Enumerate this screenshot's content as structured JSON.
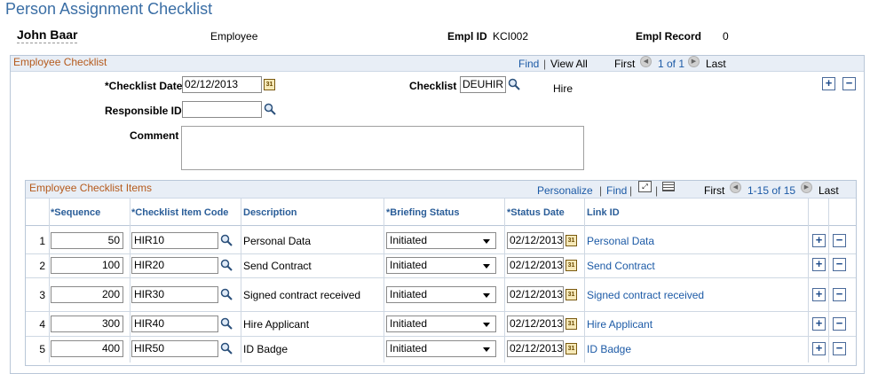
{
  "page": {
    "title": "Person Assignment Checklist"
  },
  "employee": {
    "name": "John Baar",
    "type": "Employee",
    "empl_id_label": "Empl ID",
    "empl_id": "KCI002",
    "empl_record_label": "Empl Record",
    "empl_record": "0"
  },
  "checklist_section": {
    "title": "Employee Checklist",
    "find": "Find",
    "separator": "|",
    "view_all": "View All",
    "first": "First",
    "pager": "1 of 1",
    "last": "Last",
    "checklist_date_label": "*Checklist Date",
    "checklist_date": "02/12/2013",
    "checklist_label": "Checklist",
    "checklist_value": "DEUHIR",
    "checklist_desc": "Hire",
    "responsible_id_label": "Responsible ID",
    "responsible_id": "",
    "comment_label": "Comment",
    "comment": ""
  },
  "items_grid": {
    "title": "Employee Checklist Items",
    "personalize": "Personalize",
    "separator": "|",
    "find": "Find",
    "first": "First",
    "pager": "1-15 of 15",
    "last": "Last",
    "columns": {
      "sequence": "*Sequence",
      "item_code": "*Checklist Item Code",
      "description": "Description",
      "briefing_status": "*Briefing Status",
      "status_date": "*Status Date",
      "link_id": "Link ID"
    },
    "rows": [
      {
        "n": "1",
        "sequence": "50",
        "code": "HIR10",
        "description": "Personal Data",
        "status": "Initiated",
        "date": "02/12/2013",
        "link": "Personal Data"
      },
      {
        "n": "2",
        "sequence": "100",
        "code": "HIR20",
        "description": "Send Contract",
        "status": "Initiated",
        "date": "02/12/2013",
        "link": "Send Contract"
      },
      {
        "n": "3",
        "sequence": "200",
        "code": "HIR30",
        "description": "Signed contract received",
        "status": "Initiated",
        "date": "02/12/2013",
        "link": "Signed contract received"
      },
      {
        "n": "4",
        "sequence": "300",
        "code": "HIR40",
        "description": "Hire Applicant",
        "status": "Initiated",
        "date": "02/12/2013",
        "link": "Hire Applicant"
      },
      {
        "n": "5",
        "sequence": "400",
        "code": "HIR50",
        "description": "ID Badge",
        "status": "Initiated",
        "date": "02/12/2013",
        "link": "ID Badge"
      }
    ]
  },
  "icons": {
    "calendar": "calendar-icon",
    "lookup": "lookup-icon",
    "add": "add-row-icon",
    "delete": "delete-row-icon",
    "prev": "previous-arrow-icon",
    "next": "next-arrow-icon",
    "zoom": "zoom-icon",
    "download": "download-grid-icon"
  },
  "colors": {
    "title_blue": "#3a6ea5",
    "link_blue": "#1c5aa6",
    "section_orange": "#b55a1c",
    "header_bg": "#e8eef6"
  }
}
